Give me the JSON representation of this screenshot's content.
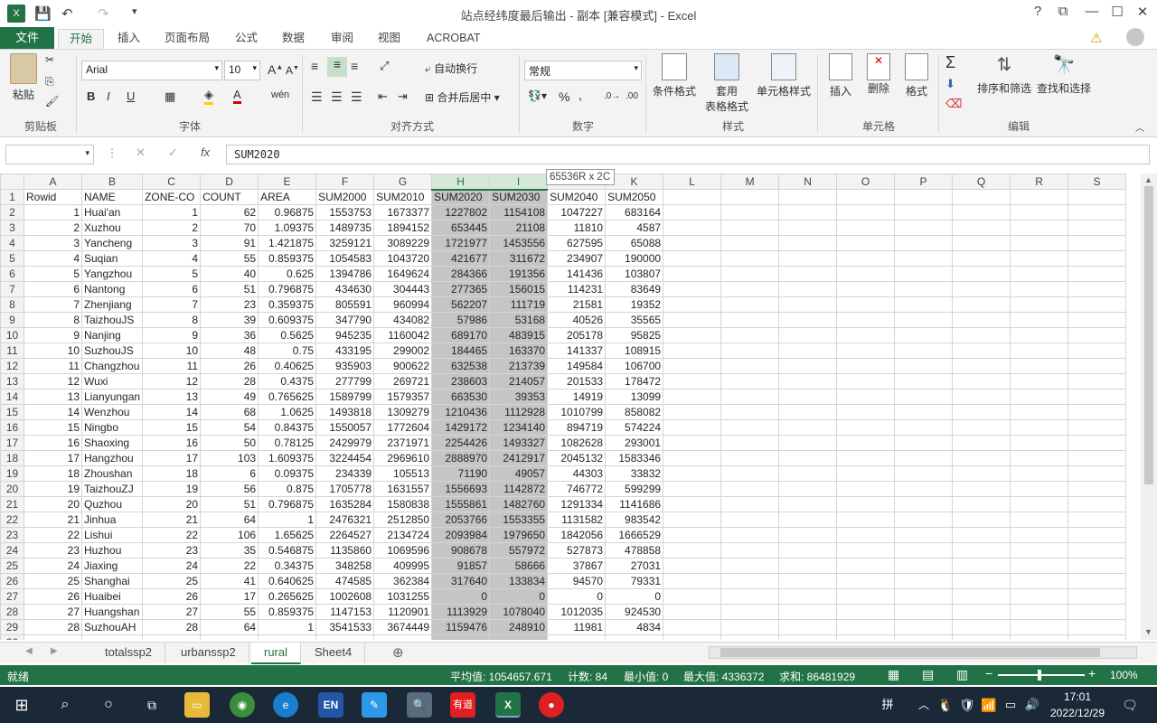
{
  "window": {
    "title": "站点经纬度最后输出 - 副本  [兼容模式] - Excel"
  },
  "ribbon_tabs": [
    "文件",
    "开始",
    "插入",
    "页面布局",
    "公式",
    "数据",
    "审阅",
    "视图",
    "ACROBAT"
  ],
  "ribbon": {
    "clipboard": {
      "paste": "粘贴",
      "label": "剪贴板"
    },
    "font": {
      "name": "Arial",
      "size": "10",
      "label": "字体"
    },
    "alignment": {
      "wrap": "自动换行",
      "merge": "合并后居中",
      "label": "对齐方式"
    },
    "number": {
      "format": "常规",
      "label": "数字"
    },
    "styles": {
      "cond": "条件格式",
      "table1": "套用",
      "table2": "表格格式",
      "cell": "单元格样式",
      "label": "样式"
    },
    "cells": {
      "insert": "插入",
      "delete": "删除",
      "format": "格式",
      "label": "单元格"
    },
    "editing": {
      "sort": "排序和筛选",
      "find": "查找和选择",
      "label": "编辑"
    }
  },
  "formula_bar": {
    "name_box": "",
    "fx": "fx",
    "formula": "SUM2020"
  },
  "tooltip": "65536R x 2C",
  "columns": [
    "A",
    "B",
    "C",
    "D",
    "E",
    "F",
    "G",
    "H",
    "I",
    "J",
    "K",
    "L",
    "M",
    "N",
    "O",
    "P",
    "Q",
    "R",
    "S"
  ],
  "rows": [
    [
      "Rowid",
      "NAME",
      "ZONE-CO",
      "COUNT",
      "AREA",
      "SUM2000",
      "SUM2010",
      "SUM2020",
      "SUM2030",
      "SUM2040",
      "SUM2050"
    ],
    [
      "1",
      "Huai'an",
      "1",
      "62",
      "0.96875",
      "1553753",
      "1673377",
      "1227802",
      "1154108",
      "1047227",
      "683164"
    ],
    [
      "2",
      "Xuzhou",
      "2",
      "70",
      "1.09375",
      "1489735",
      "1894152",
      "653445",
      "21108",
      "11810",
      "4587"
    ],
    [
      "3",
      "Yancheng",
      "3",
      "91",
      "1.421875",
      "3259121",
      "3089229",
      "1721977",
      "1453556",
      "627595",
      "65088"
    ],
    [
      "4",
      "Suqian",
      "4",
      "55",
      "0.859375",
      "1054583",
      "1043720",
      "421677",
      "311672",
      "234907",
      "190000"
    ],
    [
      "5",
      "Yangzhou",
      "5",
      "40",
      "0.625",
      "1394786",
      "1649624",
      "284366",
      "191356",
      "141436",
      "103807"
    ],
    [
      "6",
      "Nantong",
      "6",
      "51",
      "0.796875",
      "434630",
      "304443",
      "277365",
      "156015",
      "114231",
      "83649"
    ],
    [
      "7",
      "Zhenjiang",
      "7",
      "23",
      "0.359375",
      "805591",
      "960994",
      "562207",
      "111719",
      "21581",
      "19352"
    ],
    [
      "8",
      "TaizhouJS",
      "8",
      "39",
      "0.609375",
      "347790",
      "434082",
      "57986",
      "53168",
      "40526",
      "35565"
    ],
    [
      "9",
      "Nanjing",
      "9",
      "36",
      "0.5625",
      "945235",
      "1160042",
      "689170",
      "483915",
      "205178",
      "95825"
    ],
    [
      "10",
      "SuzhouJS",
      "10",
      "48",
      "0.75",
      "433195",
      "299002",
      "184465",
      "163370",
      "141337",
      "108915"
    ],
    [
      "11",
      "Changzhou",
      "11",
      "26",
      "0.40625",
      "935903",
      "900622",
      "632538",
      "213739",
      "149584",
      "106700"
    ],
    [
      "12",
      "Wuxi",
      "12",
      "28",
      "0.4375",
      "277799",
      "269721",
      "238603",
      "214057",
      "201533",
      "178472"
    ],
    [
      "13",
      "Lianyungan",
      "13",
      "49",
      "0.765625",
      "1589799",
      "1579357",
      "663530",
      "39353",
      "14919",
      "13099"
    ],
    [
      "14",
      "Wenzhou",
      "14",
      "68",
      "1.0625",
      "1493818",
      "1309279",
      "1210436",
      "1112928",
      "1010799",
      "858082"
    ],
    [
      "15",
      "Ningbo",
      "15",
      "54",
      "0.84375",
      "1550057",
      "1772604",
      "1429172",
      "1234140",
      "894719",
      "574224"
    ],
    [
      "16",
      "Shaoxing",
      "16",
      "50",
      "0.78125",
      "2429979",
      "2371971",
      "2254426",
      "1493327",
      "1082628",
      "293001"
    ],
    [
      "17",
      "Hangzhou",
      "17",
      "103",
      "1.609375",
      "3224454",
      "2969610",
      "2888970",
      "2412917",
      "2045132",
      "1583346"
    ],
    [
      "18",
      "Zhoushan",
      "18",
      "6",
      "0.09375",
      "234339",
      "105513",
      "71190",
      "49057",
      "44303",
      "33832"
    ],
    [
      "19",
      "TaizhouZJ",
      "19",
      "56",
      "0.875",
      "1705778",
      "1631557",
      "1556693",
      "1142872",
      "746772",
      "599299"
    ],
    [
      "20",
      "Quzhou",
      "20",
      "51",
      "0.796875",
      "1635284",
      "1580838",
      "1555861",
      "1482760",
      "1291334",
      "1141686"
    ],
    [
      "21",
      "Jinhua",
      "21",
      "64",
      "1",
      "2476321",
      "2512850",
      "2053766",
      "1553355",
      "1131582",
      "983542"
    ],
    [
      "22",
      "Lishui",
      "22",
      "106",
      "1.65625",
      "2264527",
      "2134724",
      "2093984",
      "1979650",
      "1842056",
      "1666529"
    ],
    [
      "23",
      "Huzhou",
      "23",
      "35",
      "0.546875",
      "1135860",
      "1069596",
      "908678",
      "557972",
      "527873",
      "478858"
    ],
    [
      "24",
      "Jiaxing",
      "24",
      "22",
      "0.34375",
      "348258",
      "409995",
      "91857",
      "58666",
      "37867",
      "27031"
    ],
    [
      "25",
      "Shanghai",
      "25",
      "41",
      "0.640625",
      "474585",
      "362384",
      "317640",
      "133834",
      "94570",
      "79331"
    ],
    [
      "26",
      "Huaibei",
      "26",
      "17",
      "0.265625",
      "1002608",
      "1031255",
      "0",
      "0",
      "0",
      "0"
    ],
    [
      "27",
      "Huangshan",
      "27",
      "55",
      "0.859375",
      "1147153",
      "1120901",
      "1113929",
      "1078040",
      "1012035",
      "924530"
    ],
    [
      "28",
      "SuzhouAH",
      "28",
      "64",
      "1",
      "3541533",
      "3674449",
      "1159476",
      "248910",
      "11981",
      "4834"
    ]
  ],
  "sheet_tabs": [
    "totalssp2",
    "urbanssp2",
    "rural",
    "Sheet4"
  ],
  "active_sheet": "rural",
  "status": {
    "ready": "就绪",
    "avg": "平均值: 1054657.671",
    "count": "计数: 84",
    "min": "最小值: 0",
    "max": "最大值: 4336372",
    "sum": "求和: 86481929",
    "zoom": "100%"
  },
  "taskbar": {
    "time": "17:01",
    "date": "2022/12/29",
    "ime": "拼",
    "youdao": "有道"
  },
  "colors": {
    "excel_green": "#217346",
    "selection": "#c5c5c5"
  }
}
